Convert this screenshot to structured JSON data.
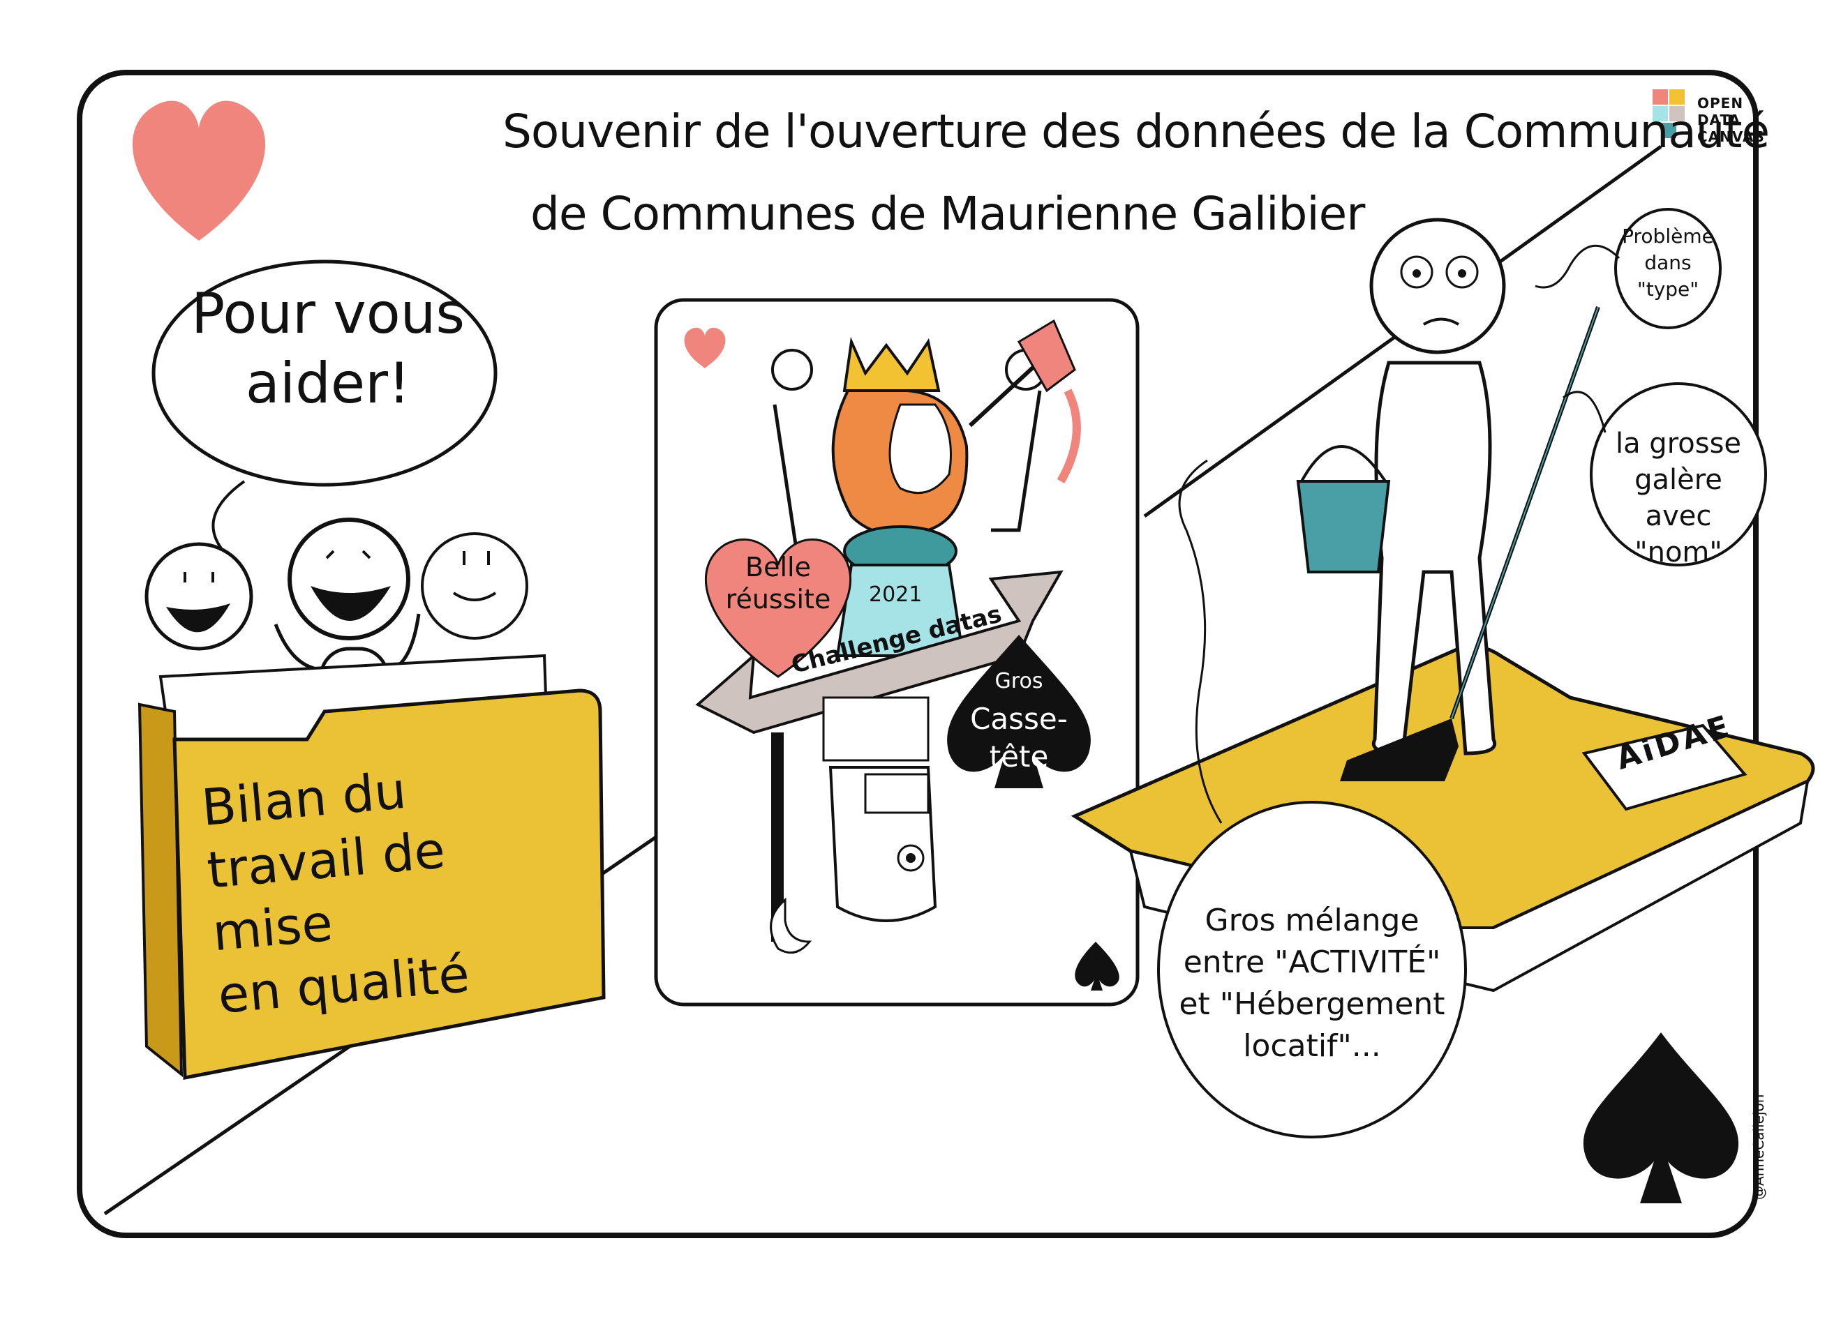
{
  "title": {
    "line1": "Souvenir de l'ouverture des données de la Communauté",
    "line2": "de Communes de Maurienne Galibier"
  },
  "logo": {
    "line1": "OPEN",
    "line2": "DATA",
    "line3": "CANVAS"
  },
  "left_panel": {
    "speech_bubble": {
      "line1": "Pour vous",
      "line2": "aider!"
    },
    "folder_label": {
      "line1": "Bilan du",
      "line2": "travail de mise",
      "line3": "en qualité"
    }
  },
  "center_card": {
    "year": "2021",
    "banner": "Challenge datas",
    "heart_badge": {
      "line1": "Belle",
      "line2": "réussite"
    },
    "spade_badge": {
      "line1": "Gros",
      "line2": "Casse-tête"
    }
  },
  "right_panel": {
    "thought_top": {
      "line1": "Problème",
      "line2": "dans",
      "line3": "\"type\""
    },
    "thought_middle": {
      "line1": "la grosse",
      "line2": "galère avec",
      "line3": "\"nom\""
    },
    "thought_bottom": {
      "line1": "Gros mélange",
      "line2": "entre \"ACTIVITÉ\"",
      "line3": "et \"Hébergement",
      "line4": "locatif\"..."
    },
    "folder_tag": "AiDAE"
  },
  "signature": "@AnneCallejon",
  "colors": {
    "heart": "#ef857d",
    "folder": "#ebc136",
    "folder_dark": "#c99a1a",
    "bucket": "#4a9ea5",
    "hair": "#ef8a45",
    "crown": "#f2c232",
    "card_bg": "#ffffff",
    "banner": "#cfc3c0",
    "dress": "#a6e3e6",
    "collar": "#3f9a9e",
    "ink": "#111111"
  }
}
